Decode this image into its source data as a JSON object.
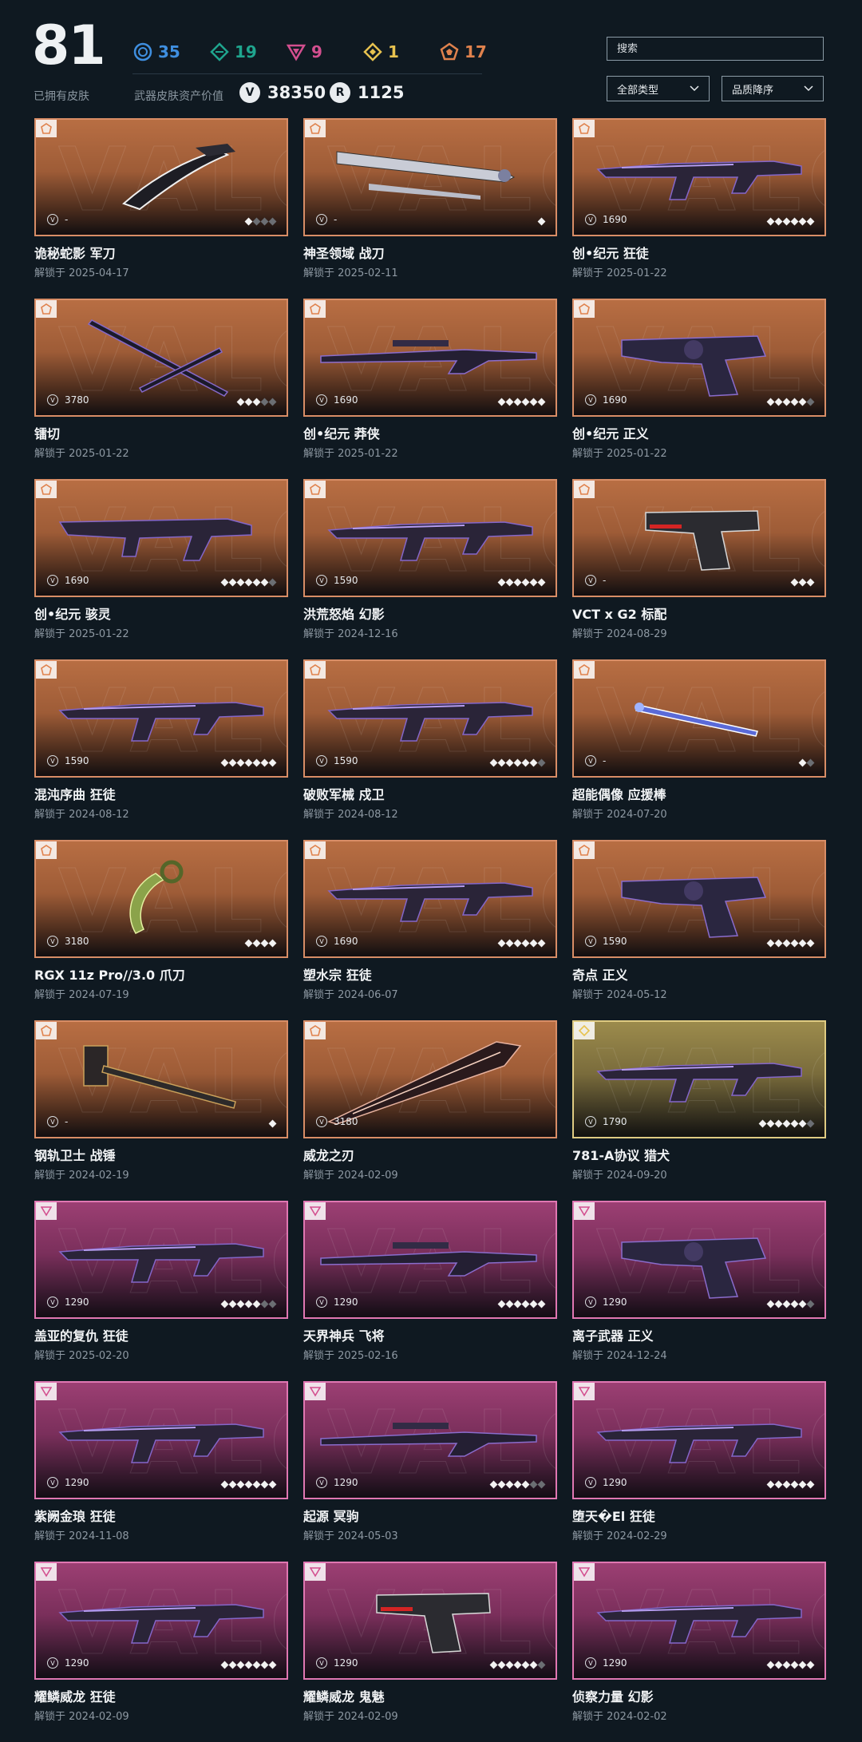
{
  "header": {
    "owned_count": "81",
    "owned_label": "已拥有皮肤",
    "tiers": [
      {
        "icon": "select-tier-icon",
        "count": "35",
        "color": "#3f8fe0"
      },
      {
        "icon": "deluxe-tier-icon",
        "count": "19",
        "color": "#1fa58e"
      },
      {
        "icon": "premium-tier-icon",
        "count": "9",
        "color": "#d34f8f"
      },
      {
        "icon": "ultra-tier-icon",
        "count": "1",
        "color": "#e7c24f"
      },
      {
        "icon": "exclusive-tier-icon",
        "count": "17",
        "color": "#e0824d"
      }
    ],
    "asset_label": "武器皮肤资产价值",
    "vp_value": "38350",
    "rp_value": "1125",
    "search_placeholder": "搜索",
    "type_filter": "全部类型",
    "sort_filter": "品质降序"
  },
  "skins": [
    {
      "name": "诡秘蛇影 军刀",
      "date": "解锁于 2025-04-17",
      "price": "-",
      "tier": "orange",
      "gems_on": 1,
      "gems_total": 4,
      "weapon": "knife-icon"
    },
    {
      "name": "神圣领域 战刀",
      "date": "解锁于 2025-02-11",
      "price": "-",
      "tier": "orange",
      "gems_on": 1,
      "gems_total": 1,
      "weapon": "sword-icon"
    },
    {
      "name": "创•纪元 狂徒",
      "date": "解锁于 2025-01-22",
      "price": "1690",
      "tier": "orange",
      "gems_on": 6,
      "gems_total": 6,
      "weapon": "rifle-icon"
    },
    {
      "name": "镭切",
      "date": "解锁于 2025-01-22",
      "price": "3780",
      "tier": "orange",
      "gems_on": 3,
      "gems_total": 5,
      "weapon": "katana-icon"
    },
    {
      "name": "创•纪元 莽侠",
      "date": "解锁于 2025-01-22",
      "price": "1690",
      "tier": "orange",
      "gems_on": 6,
      "gems_total": 6,
      "weapon": "sniper-icon"
    },
    {
      "name": "创•纪元 正义",
      "date": "解锁于 2025-01-22",
      "price": "1690",
      "tier": "orange",
      "gems_on": 5,
      "gems_total": 6,
      "weapon": "revolver-icon"
    },
    {
      "name": "创•纪元 骇灵",
      "date": "解锁于 2025-01-22",
      "price": "1690",
      "tier": "orange",
      "gems_on": 6,
      "gems_total": 7,
      "weapon": "smg-icon"
    },
    {
      "name": "洪荒怒焰 幻影",
      "date": "解锁于 2024-12-16",
      "price": "1590",
      "tier": "orange",
      "gems_on": 6,
      "gems_total": 6,
      "weapon": "rifle-icon"
    },
    {
      "name": "VCT x G2 标配",
      "date": "解锁于 2024-08-29",
      "price": "-",
      "tier": "orange",
      "gems_on": 3,
      "gems_total": 3,
      "weapon": "pistol-icon"
    },
    {
      "name": "混沌序曲 狂徒",
      "date": "解锁于 2024-08-12",
      "price": "1590",
      "tier": "orange",
      "gems_on": 7,
      "gems_total": 7,
      "weapon": "rifle-icon"
    },
    {
      "name": "破败军械 戍卫",
      "date": "解锁于 2024-08-12",
      "price": "1590",
      "tier": "orange",
      "gems_on": 6,
      "gems_total": 7,
      "weapon": "rifle-icon"
    },
    {
      "name": "超能偶像 应援棒",
      "date": "解锁于 2024-07-20",
      "price": "-",
      "tier": "orange",
      "gems_on": 1,
      "gems_total": 2,
      "weapon": "baton-icon"
    },
    {
      "name": "RGX 11z Pro//3.0 爪刀",
      "date": "解锁于 2024-07-19",
      "price": "3180",
      "tier": "orange",
      "gems_on": 4,
      "gems_total": 4,
      "weapon": "karambit-icon"
    },
    {
      "name": "塑水宗 狂徒",
      "date": "解锁于 2024-06-07",
      "price": "1690",
      "tier": "orange",
      "gems_on": 6,
      "gems_total": 6,
      "weapon": "rifle-icon"
    },
    {
      "name": "奇点 正义",
      "date": "解锁于 2024-05-12",
      "price": "1590",
      "tier": "orange",
      "gems_on": 6,
      "gems_total": 6,
      "weapon": "revolver-icon"
    },
    {
      "name": "钢轨卫士 战锤",
      "date": "解锁于 2024-02-19",
      "price": "-",
      "tier": "orange",
      "gems_on": 1,
      "gems_total": 1,
      "weapon": "hammer-icon"
    },
    {
      "name": "威龙之刃",
      "date": "解锁于 2024-02-09",
      "price": "3180",
      "tier": "orange",
      "gems_on": 0,
      "gems_total": 0,
      "weapon": "blade-icon"
    },
    {
      "name": "781-A协议 猎犬",
      "date": "解锁于 2024-09-20",
      "price": "1790",
      "tier": "gold",
      "gems_on": 6,
      "gems_total": 7,
      "weapon": "rifle-icon"
    },
    {
      "name": "盖亚的复仇 狂徒",
      "date": "解锁于 2025-02-20",
      "price": "1290",
      "tier": "pink",
      "gems_on": 5,
      "gems_total": 7,
      "weapon": "rifle-icon"
    },
    {
      "name": "天界神兵 飞将",
      "date": "解锁于 2025-02-16",
      "price": "1290",
      "tier": "pink",
      "gems_on": 6,
      "gems_total": 6,
      "weapon": "sniper-icon"
    },
    {
      "name": "离子武器 正义",
      "date": "解锁于 2024-12-24",
      "price": "1290",
      "tier": "pink",
      "gems_on": 5,
      "gems_total": 6,
      "weapon": "revolver-icon"
    },
    {
      "name": "紫阙金琅 狂徒",
      "date": "解锁于 2024-11-08",
      "price": "1290",
      "tier": "pink",
      "gems_on": 7,
      "gems_total": 7,
      "weapon": "rifle-icon"
    },
    {
      "name": "起源 冥驹",
      "date": "解锁于 2024-05-03",
      "price": "1290",
      "tier": "pink",
      "gems_on": 5,
      "gems_total": 7,
      "weapon": "sniper-icon"
    },
    {
      "name": "堕天�El 狂徒",
      "date": "解锁于 2024-02-29",
      "price": "1290",
      "tier": "pink",
      "gems_on": 6,
      "gems_total": 6,
      "weapon": "rifle-icon"
    },
    {
      "name": "耀鳞威龙 狂徒",
      "date": "解锁于 2024-02-09",
      "price": "1290",
      "tier": "pink",
      "gems_on": 7,
      "gems_total": 7,
      "weapon": "rifle-icon"
    },
    {
      "name": "耀鳞威龙 鬼魅",
      "date": "解锁于 2024-02-09",
      "price": "1290",
      "tier": "pink",
      "gems_on": 6,
      "gems_total": 7,
      "weapon": "pistol-icon"
    },
    {
      "name": "侦察力量 幻影",
      "date": "解锁于 2024-02-02",
      "price": "1290",
      "tier": "pink",
      "gems_on": 6,
      "gems_total": 6,
      "weapon": "rifle-icon"
    }
  ]
}
